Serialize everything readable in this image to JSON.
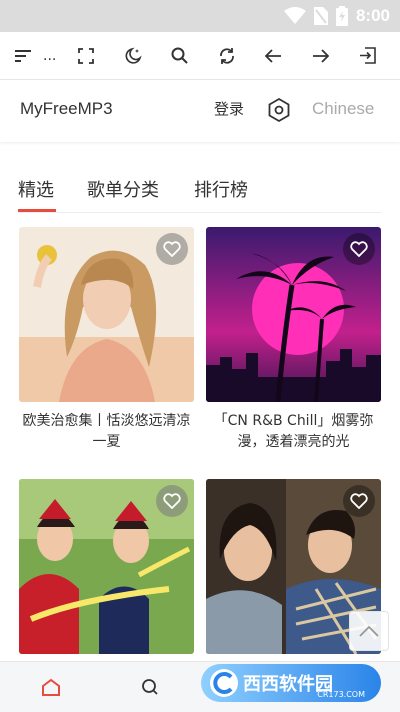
{
  "status": {
    "time": "8:00"
  },
  "header": {
    "brand": "MyFreeMP3",
    "login": "登录",
    "language": "Chinese"
  },
  "tabs": [
    {
      "label": "精选",
      "active": true
    },
    {
      "label": "歌单分类",
      "active": false
    },
    {
      "label": "排行榜",
      "active": false
    }
  ],
  "toolbar": {
    "ellipsis": "..."
  },
  "playlists": [
    {
      "title": "欧美治愈集丨恬淡悠远清凉一夏"
    },
    {
      "title": "「CN R&B Chill」烟雾弥漫，透着漂亮的光"
    },
    {
      "title": ""
    },
    {
      "title": ""
    }
  ],
  "watermark": {
    "text": "西西软件园",
    "sub": "CR173.COM"
  },
  "colors": {
    "accent": "#e74c3c",
    "header_bg": "#ffffff",
    "status_bg": "#dcdcdc"
  }
}
